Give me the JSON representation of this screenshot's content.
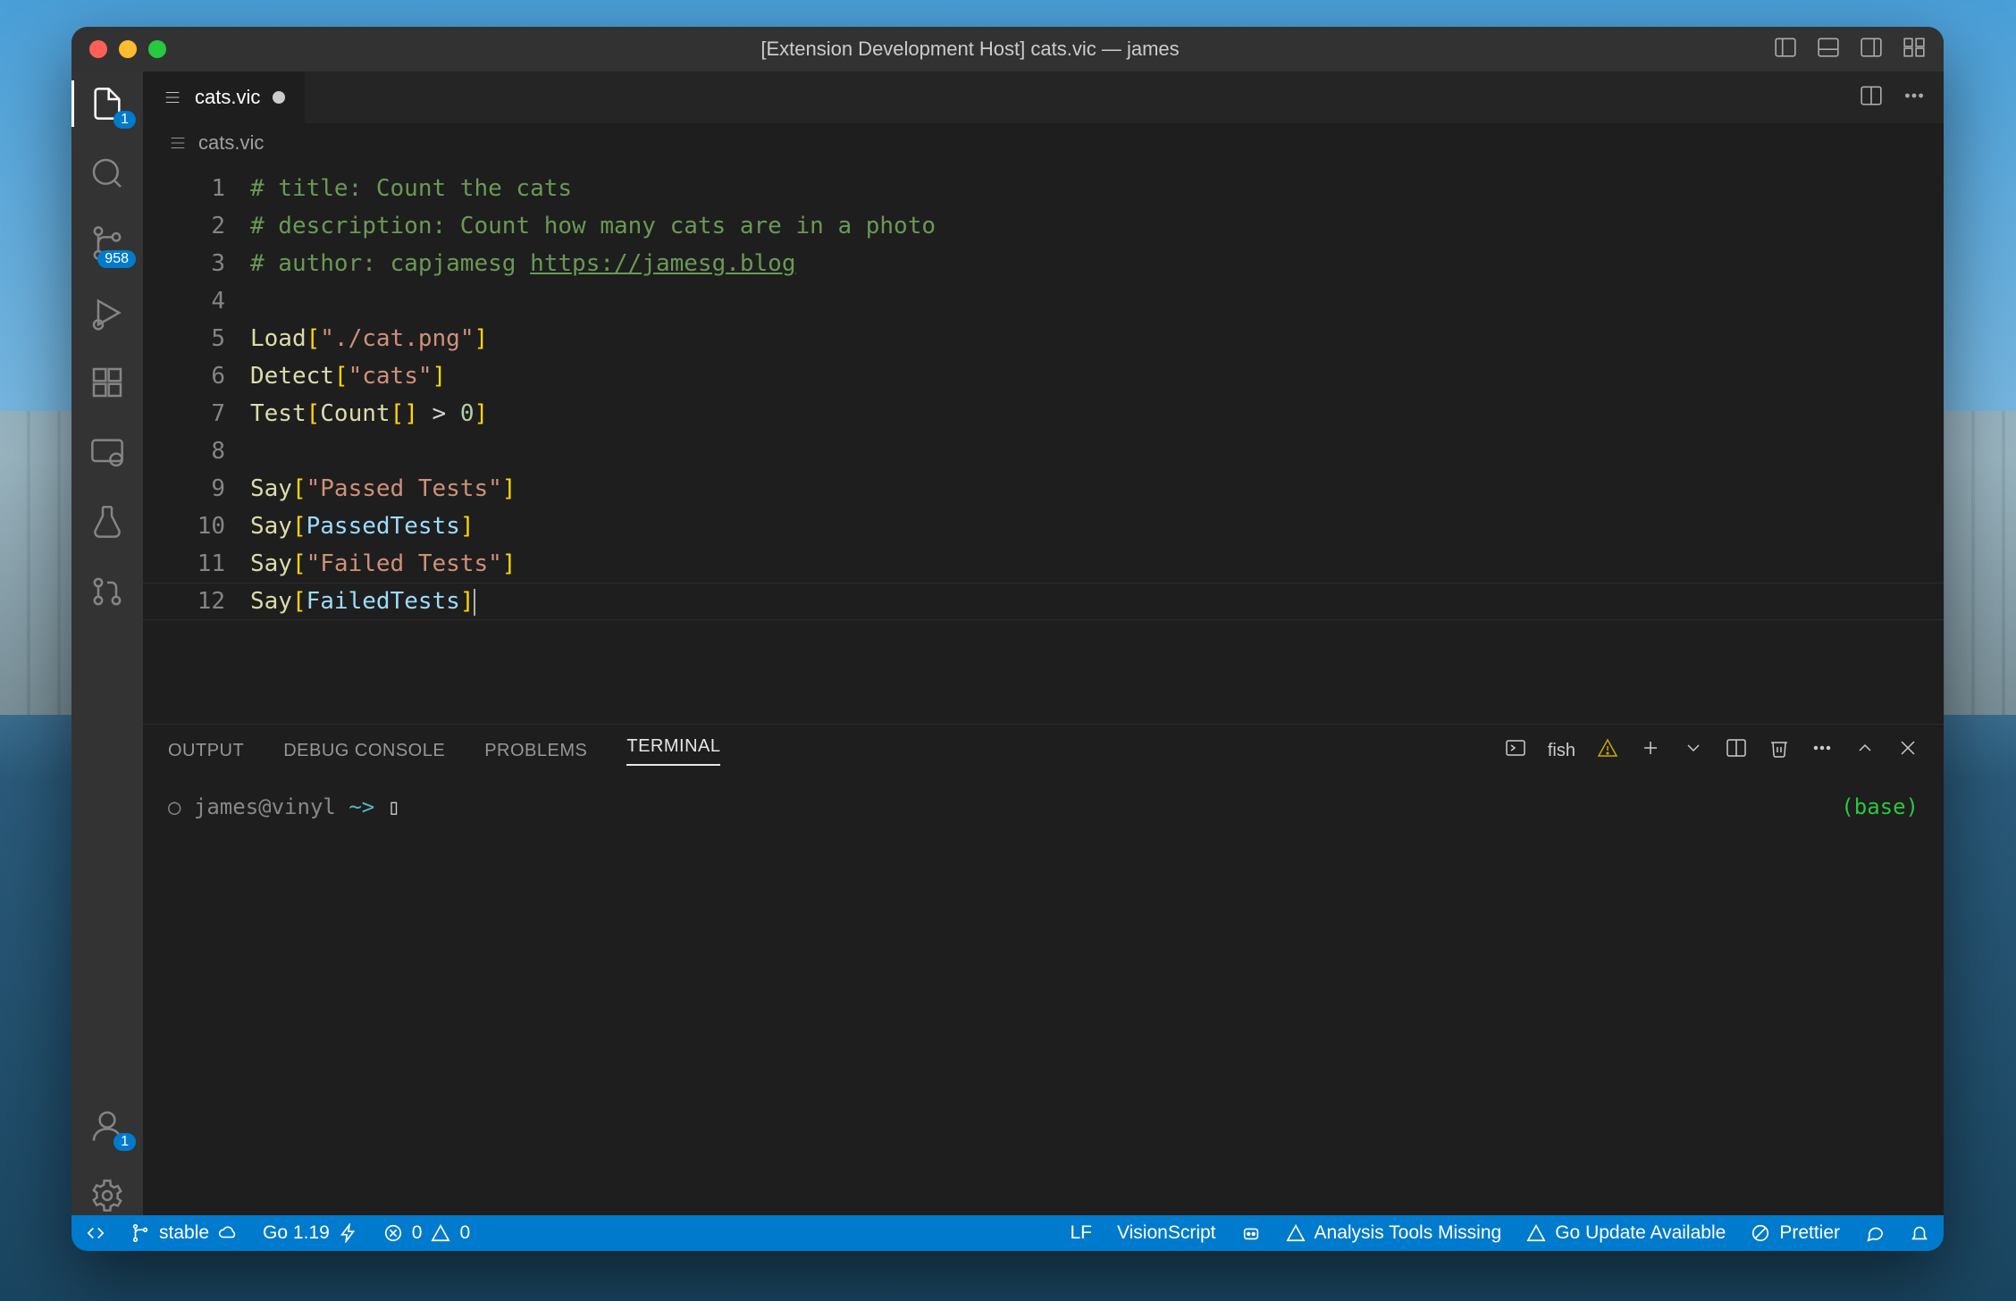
{
  "window_title": "[Extension Development Host] cats.vic — james",
  "activity_badges": {
    "explorer": "1",
    "scm": "958",
    "account": "1"
  },
  "tab": {
    "filename": "cats.vic",
    "dirty": true
  },
  "breadcrumb": "cats.vic",
  "editor": {
    "line_numbers": [
      "1",
      "2",
      "3",
      "4",
      "5",
      "6",
      "7",
      "8",
      "9",
      "10",
      "11",
      "12"
    ],
    "lines": [
      [
        {
          "c": "tok-comment",
          "t": "# title: Count the cats"
        }
      ],
      [
        {
          "c": "tok-comment",
          "t": "# description: Count how many cats are in a photo"
        }
      ],
      [
        {
          "c": "tok-comment",
          "t": "# author: capjamesg "
        },
        {
          "c": "tok-link",
          "t": "https://jamesg.blog"
        }
      ],
      [
        {
          "c": "",
          "t": ""
        }
      ],
      [
        {
          "c": "tok-fn",
          "t": "Load"
        },
        {
          "c": "tok-br",
          "t": "["
        },
        {
          "c": "tok-str",
          "t": "\"./cat.png\""
        },
        {
          "c": "tok-br",
          "t": "]"
        }
      ],
      [
        {
          "c": "tok-fn",
          "t": "Detect"
        },
        {
          "c": "tok-br",
          "t": "["
        },
        {
          "c": "tok-str",
          "t": "\"cats\""
        },
        {
          "c": "tok-br",
          "t": "]"
        }
      ],
      [
        {
          "c": "tok-fn",
          "t": "Test"
        },
        {
          "c": "tok-br",
          "t": "["
        },
        {
          "c": "tok-fn",
          "t": "Count"
        },
        {
          "c": "tok-br",
          "t": "[]"
        },
        {
          "c": "tok-op",
          "t": " > "
        },
        {
          "c": "tok-num",
          "t": "0"
        },
        {
          "c": "tok-br",
          "t": "]"
        }
      ],
      [
        {
          "c": "",
          "t": ""
        }
      ],
      [
        {
          "c": "tok-fn",
          "t": "Say"
        },
        {
          "c": "tok-br",
          "t": "["
        },
        {
          "c": "tok-str",
          "t": "\"Passed Tests\""
        },
        {
          "c": "tok-br",
          "t": "]"
        }
      ],
      [
        {
          "c": "tok-fn",
          "t": "Say"
        },
        {
          "c": "tok-br",
          "t": "["
        },
        {
          "c": "tok-id",
          "t": "PassedTests"
        },
        {
          "c": "tok-br",
          "t": "]"
        }
      ],
      [
        {
          "c": "tok-fn",
          "t": "Say"
        },
        {
          "c": "tok-br",
          "t": "["
        },
        {
          "c": "tok-str",
          "t": "\"Failed Tests\""
        },
        {
          "c": "tok-br",
          "t": "]"
        }
      ],
      [
        {
          "c": "tok-fn",
          "t": "Say"
        },
        {
          "c": "tok-br",
          "t": "["
        },
        {
          "c": "tok-id",
          "t": "FailedTests"
        },
        {
          "c": "tok-br",
          "t": "]"
        },
        {
          "c": "cursor",
          "t": ""
        }
      ]
    ]
  },
  "panel": {
    "tabs": {
      "output": "OUTPUT",
      "debug": "DEBUG CONSOLE",
      "problems": "PROBLEMS",
      "terminal": "TERMINAL"
    },
    "shell_label": "fish",
    "prompt": {
      "user": "james",
      "host": "vinyl",
      "path": "~>",
      "env": "(base)"
    }
  },
  "status": {
    "remote": "",
    "branch": "stable",
    "go": "Go 1.19",
    "errors": "0",
    "warnings": "0",
    "eol": "LF",
    "lang": "VisionScript",
    "analysis": "Analysis Tools Missing",
    "goupdate": "Go Update Available",
    "prettier": "Prettier"
  }
}
